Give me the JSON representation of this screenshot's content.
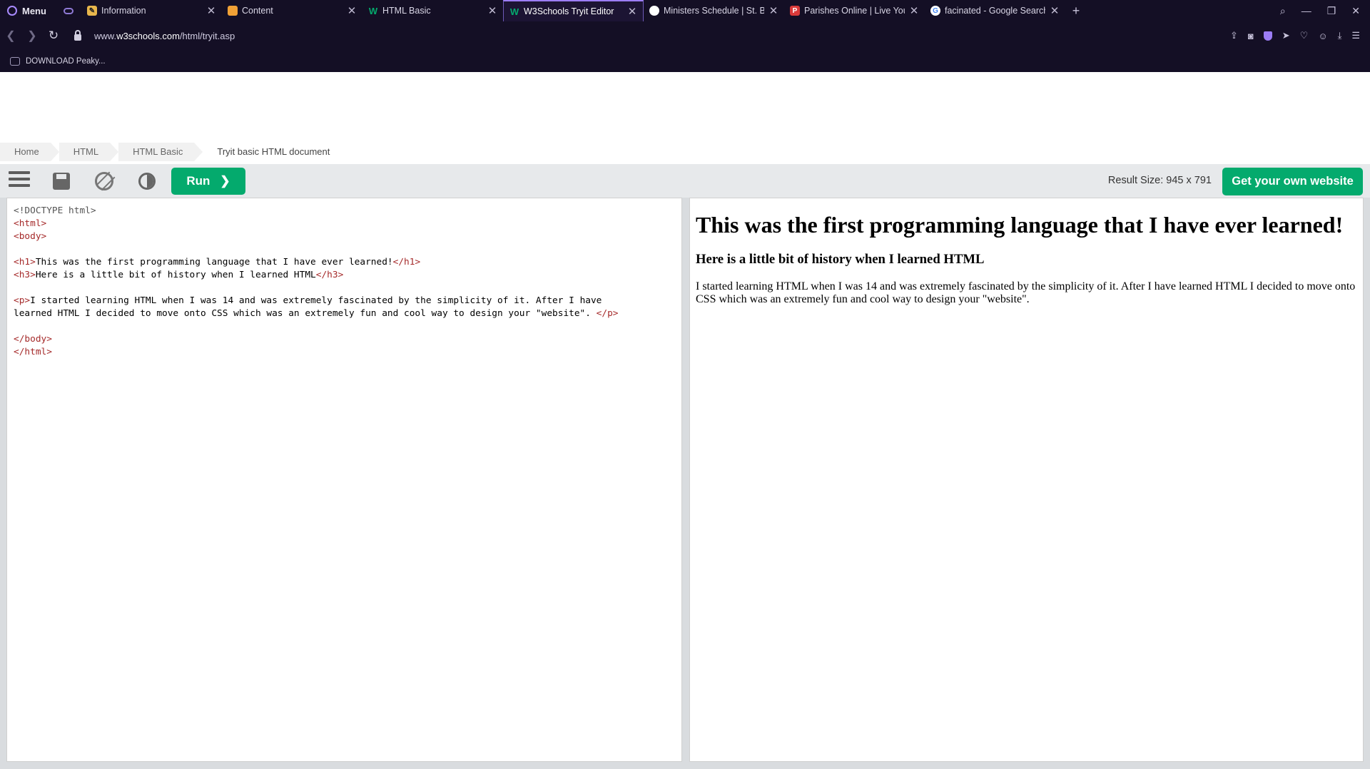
{
  "browser": {
    "menu_label": "Menu",
    "tabs": [
      {
        "title": "Information",
        "icon": "information-favicon"
      },
      {
        "title": "Content",
        "icon": "content-favicon"
      },
      {
        "title": "HTML Basic",
        "icon": "w3schools-favicon"
      },
      {
        "title": "W3Schools Tryit Editor",
        "icon": "w3schools-favicon",
        "active": true
      },
      {
        "title": "Ministers Schedule | St. Bar",
        "icon": "globe-favicon"
      },
      {
        "title": "Parishes Online | Live Your",
        "icon": "parishes-favicon"
      },
      {
        "title": "facinated - Google Search",
        "icon": "google-favicon"
      }
    ],
    "url_prefix": "www.",
    "url_domain": "w3schools.com",
    "url_path": "/html/tryit.asp",
    "bookmark": "DOWNLOAD Peaky..."
  },
  "breadcrumb": [
    "Home",
    "HTML",
    "HTML Basic",
    "Tryit basic HTML document"
  ],
  "toolbar": {
    "run_label": "Run",
    "run_chevron": "❯",
    "result_size": "Result Size: 945 x 791",
    "own_website_label": "Get your own website"
  },
  "code": {
    "l1": "<!DOCTYPE html>",
    "l2": "<html>",
    "l3": "<body>",
    "h1_open": "<h1>",
    "h1_text": "This was the first programming language that I have ever learned!",
    "h1_close": "</h1>",
    "h3_open": "<h3>",
    "h3_text": "Here is a little bit of history when I learned HTML",
    "h3_close": "</h3>",
    "p_open": "<p>",
    "p_text1": "I started learning HTML when I was 14 and was extremely fascinated by the simplicity of it. After I have",
    "p_text2": "learned HTML I decided to move onto CSS which was an extremely fun and cool way to design your \"website\". ",
    "p_close": "</p>",
    "l_body_close": "</body>",
    "l_html_close": "</html>"
  },
  "result": {
    "h1": "This was the first programming language that I have ever learned!",
    "h3": "Here is a little bit of history when I learned HTML",
    "p": "I started learning HTML when I was 14 and was extremely fascinated by the simplicity of it. After I have learned HTML I decided to move onto CSS which was an extremely fun and cool way to design your \"website\"."
  },
  "colors": {
    "chrome_bg": "#140f25",
    "accent": "#9c7df5",
    "w3_green": "#04aa6d",
    "toolbar_bg": "#e7e9eb"
  }
}
